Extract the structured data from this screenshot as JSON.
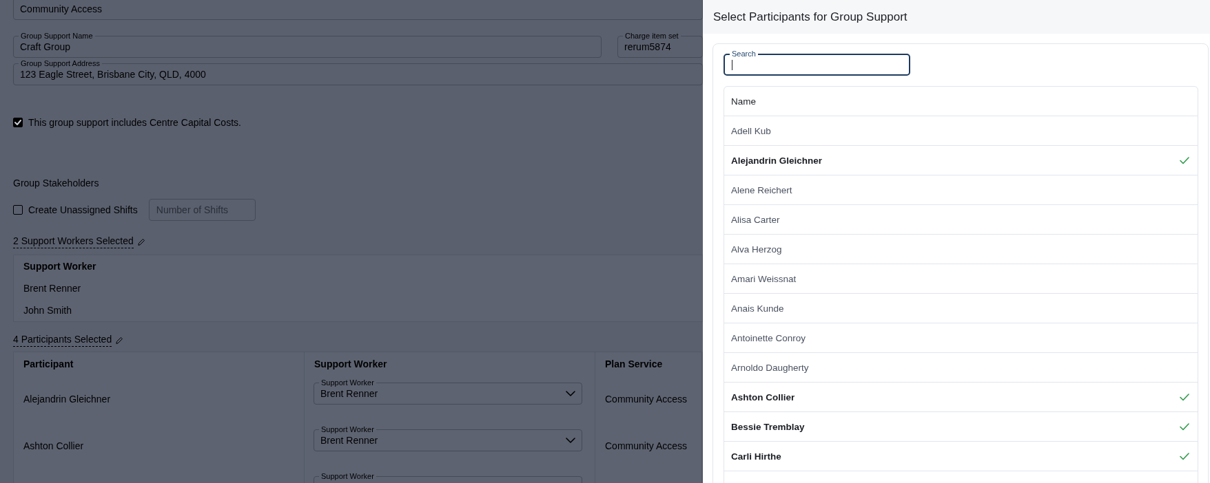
{
  "background_form": {
    "support_type_field": {
      "value": "Community Access"
    },
    "fields": [
      {
        "label": "Group Support Name",
        "value": "Craft Group"
      },
      {
        "label": "Charge item set",
        "value": "rerum5874"
      }
    ],
    "address_field": {
      "label": "Group Support Address",
      "value": "123 Eagle Street, Brisbane City, QLD, 4000"
    },
    "centre_capital_costs": {
      "label": "This group support includes Centre Capital Costs.",
      "checked": true
    },
    "section_title": "Group Stakeholders",
    "unassigned_shifts": {
      "label": "Create Unassigned Shifts",
      "checked": false,
      "placeholder": "Number of Shifts"
    },
    "support_workers": {
      "summary": "2 Support Workers Selected",
      "column": "Support Worker",
      "rows": [
        "Brent Renner",
        "John Smith"
      ]
    },
    "participants": {
      "summary": "4 Participants Selected",
      "columns": [
        "Participant",
        "Support Worker",
        "Plan Service"
      ],
      "rows": [
        {
          "participant": "Alejandrin Gleichner",
          "support_worker": {
            "label": "Support Worker",
            "value": "Brent Renner"
          },
          "plan_service": "Community Access"
        },
        {
          "participant": "Ashton Collier",
          "support_worker": {
            "label": "Support Worker",
            "value": "Brent Renner"
          },
          "plan_service": "Community Access"
        },
        {
          "support_worker": {
            "label": "Support Worker"
          }
        }
      ]
    }
  },
  "drawer": {
    "title": "Select Participants for Group Support",
    "search": {
      "label": "Search"
    },
    "table": {
      "column": "Name",
      "rows": [
        {
          "name": "Adell Kub",
          "selected": false
        },
        {
          "name": "Alejandrin Gleichner",
          "selected": true
        },
        {
          "name": "Alene Reichert",
          "selected": false
        },
        {
          "name": "Alisa Carter",
          "selected": false
        },
        {
          "name": "Alva Herzog",
          "selected": false
        },
        {
          "name": "Amari Weissnat",
          "selected": false
        },
        {
          "name": "Anais Kunde",
          "selected": false
        },
        {
          "name": "Antoinette Conroy",
          "selected": false
        },
        {
          "name": "Arnoldo Daugherty",
          "selected": false
        },
        {
          "name": "Ashton Collier",
          "selected": true
        },
        {
          "name": "Bessie Tremblay",
          "selected": true
        },
        {
          "name": "Carli Hirthe",
          "selected": true
        }
      ]
    }
  }
}
